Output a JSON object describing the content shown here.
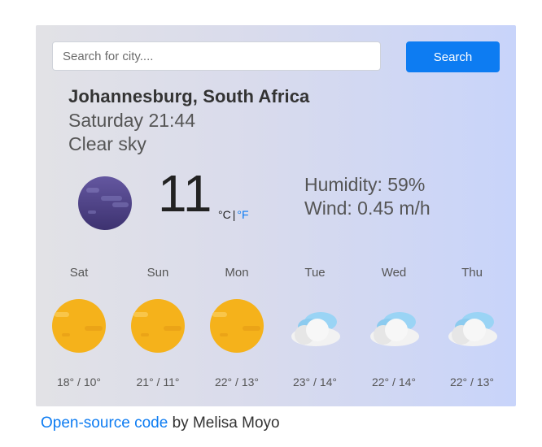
{
  "search": {
    "placeholder": "Search for city....",
    "button_label": "Search"
  },
  "current": {
    "city": "Johannesburg, South Africa",
    "datetime": "Saturday 21:44",
    "description": "Clear sky",
    "temperature": "11",
    "unit_celsius": "°C",
    "unit_separator": "|",
    "unit_fahrenheit": "°F",
    "humidity": "Humidity: 59%",
    "wind": "Wind: 0.45 m/h",
    "icon": "moon-icon"
  },
  "forecast": [
    {
      "day": "Sat",
      "temp": "18° / 10°",
      "icon": "sun-icon"
    },
    {
      "day": "Sun",
      "temp": "21° / 11°",
      "icon": "sun-icon"
    },
    {
      "day": "Mon",
      "temp": "22° / 13°",
      "icon": "sun-icon"
    },
    {
      "day": "Tue",
      "temp": "23° / 14°",
      "icon": "cloud-icon"
    },
    {
      "day": "Wed",
      "temp": "22° / 14°",
      "icon": "cloud-icon"
    },
    {
      "day": "Thu",
      "temp": "22° / 13°",
      "icon": "cloud-icon"
    }
  ],
  "footer": {
    "link_text": "Open-source code",
    "byline": " by Melisa Moyo"
  },
  "colors": {
    "accent": "#0d7cf2",
    "sun": "#f5b21b",
    "moon": "#4b3f7e",
    "cloud": "#9ad4f5"
  }
}
